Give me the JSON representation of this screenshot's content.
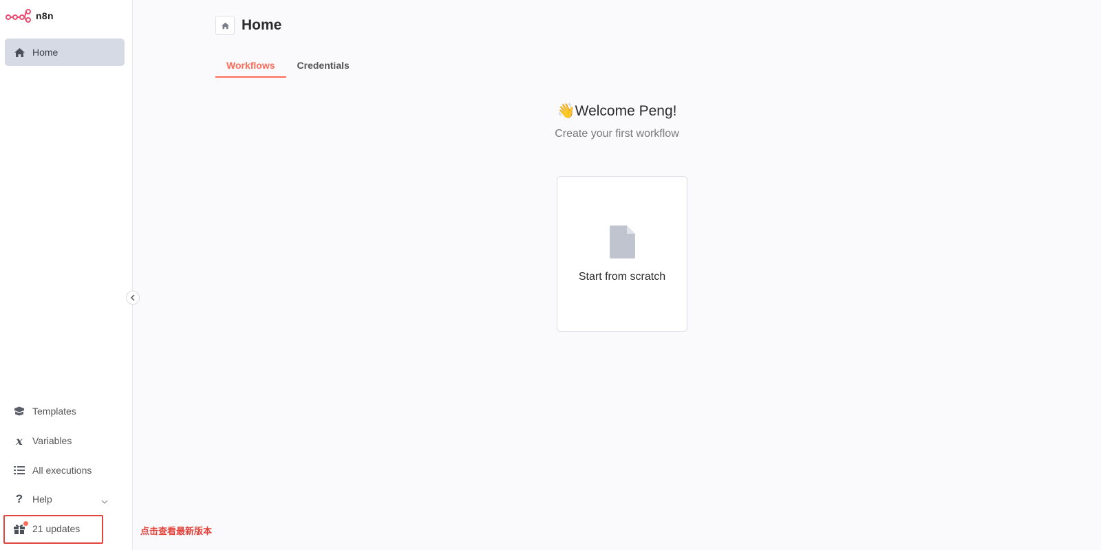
{
  "app": {
    "name": "n8n",
    "accent_color": "#ff6d5a"
  },
  "sidebar": {
    "main_items": [
      {
        "label": "Home",
        "icon": "home-icon",
        "active": true
      }
    ],
    "bottom_items": [
      {
        "label": "Templates",
        "icon": "box-icon"
      },
      {
        "label": "Variables",
        "icon": "variable-icon"
      },
      {
        "label": "All executions",
        "icon": "list-check-icon"
      },
      {
        "label": "Help",
        "icon": "question-icon",
        "has_dropdown": true
      },
      {
        "label": "21 updates",
        "icon": "gift-icon",
        "has_notification": true
      }
    ]
  },
  "annotation": {
    "text": "点击查看最新版本",
    "color": "#e2453c"
  },
  "header": {
    "title": "Home"
  },
  "tabs": [
    {
      "label": "Workflows",
      "active": true
    },
    {
      "label": "Credentials",
      "active": false
    }
  ],
  "welcome": {
    "emoji": "👋",
    "title": "Welcome Peng!",
    "subtitle": "Create your first workflow"
  },
  "start_card": {
    "label": "Start from scratch",
    "icon": "file-icon"
  }
}
